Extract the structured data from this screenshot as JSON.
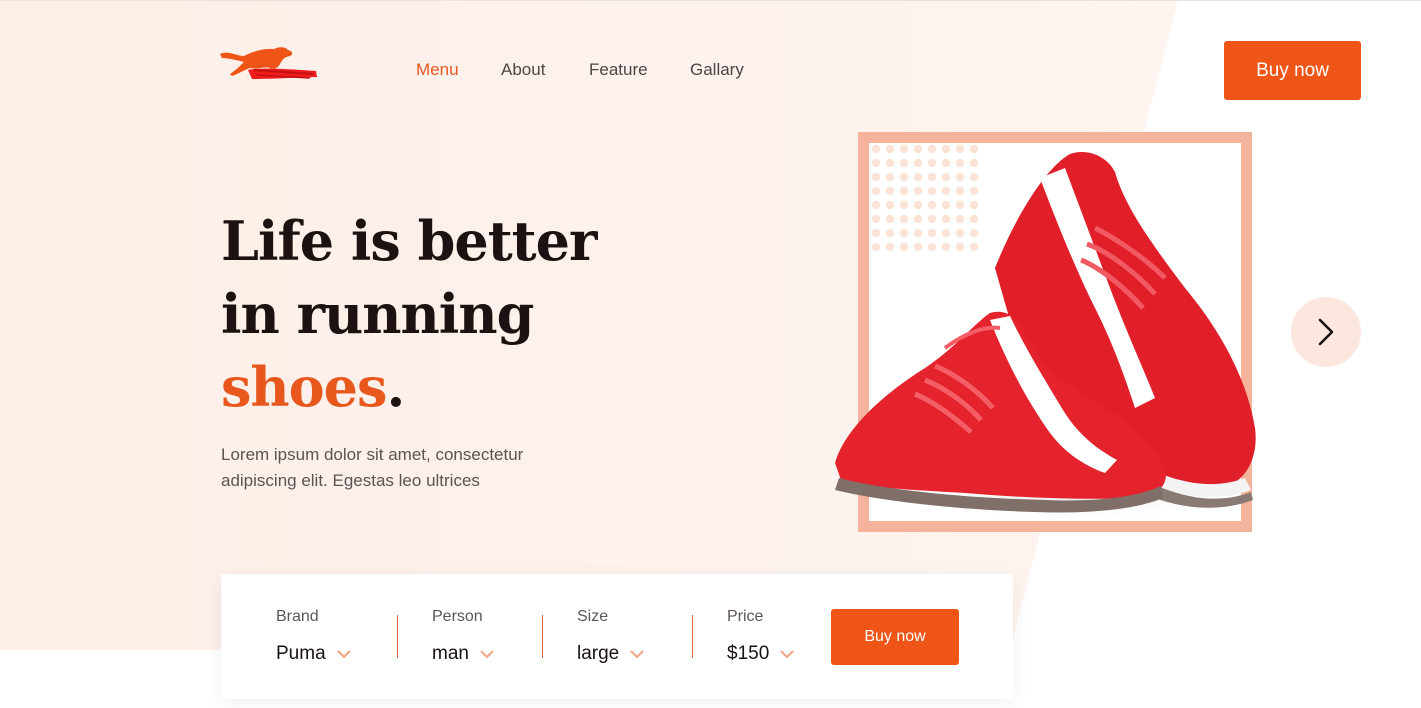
{
  "header": {
    "logo_icon": "puma-cat-logo-icon",
    "nav": [
      {
        "label": "Menu",
        "active": true
      },
      {
        "label": "About",
        "active": false
      },
      {
        "label": "Feature",
        "active": false
      },
      {
        "label": "Gallary",
        "active": false
      }
    ],
    "buy_label": "Buy now"
  },
  "hero": {
    "headline_line1": "Life is better",
    "headline_line2": "in running",
    "headline_accent": "shoes",
    "headline_period": ".",
    "subtext_line1": "Lorem ipsum dolor sit amet, consectetur",
    "subtext_line2": "adipiscing elit. Egestas leo ultrices"
  },
  "carousel": {
    "next_icon": "chevron-right-icon",
    "image_icon": "red-sneakers-image"
  },
  "filters": [
    {
      "label": "Brand",
      "value": "Puma"
    },
    {
      "label": "Person",
      "value": "man"
    },
    {
      "label": "Size",
      "value": "large"
    },
    {
      "label": "Price",
      "value": "$150"
    }
  ],
  "filter_buy_label": "Buy now",
  "colors": {
    "accent": "#ee5517",
    "frame": "#f4b39a",
    "background": "#fdf1eb"
  }
}
